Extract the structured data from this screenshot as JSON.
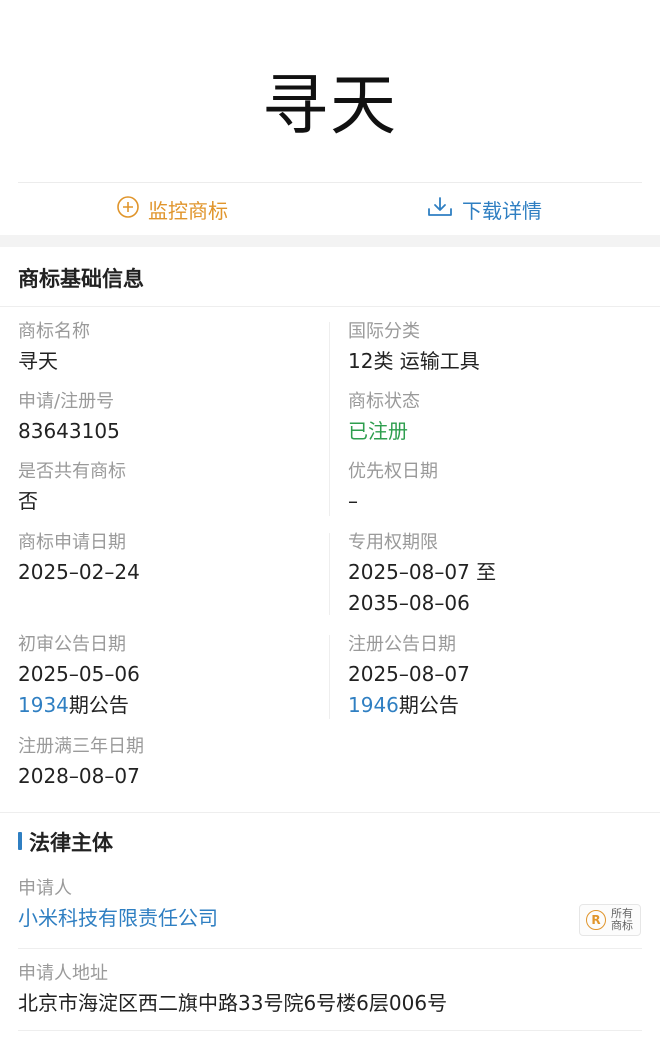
{
  "trademark_name": "寻天",
  "actions": {
    "monitor_label": "监控商标",
    "download_label": "下载详情"
  },
  "basic_info": {
    "title": "商标基础信息",
    "name_label": "商标名称",
    "name_value": "寻天",
    "class_label": "国际分类",
    "class_value": "12类 运输工具",
    "reg_no_label": "申请/注册号",
    "reg_no_value": "83643105",
    "status_label": "商标状态",
    "status_value": "已注册",
    "shared_label": "是否共有商标",
    "shared_value": "否",
    "priority_label": "优先权日期",
    "priority_value": "–",
    "apply_date_label": "商标申请日期",
    "apply_date_value": "2025–02–24",
    "exclusive_label": "专用权期限",
    "exclusive_value_1": "2025–08–07 至",
    "exclusive_value_2": "2035–08–06",
    "prelim_label": "初审公告日期",
    "prelim_date": "2025–05–06",
    "prelim_issue": "1934",
    "prelim_issue_suffix": "期公告",
    "reg_pub_label": "注册公告日期",
    "reg_pub_date": "2025–08–07",
    "reg_pub_issue": "1946",
    "reg_pub_issue_suffix": "期公告",
    "three_year_label": "注册满三年日期",
    "three_year_value": "2028–08–07"
  },
  "legal": {
    "title": "法律主体",
    "applicant_label": "申请人",
    "applicant_value": "小米科技有限责任公司",
    "badge_symbol": "R",
    "badge_line1": "所有",
    "badge_line2": "商标",
    "address_label": "申请人地址",
    "address_value": "北京市海淀区西二旗中路33号院6号楼6层006号"
  },
  "colors": {
    "accent_orange": "#e0952c",
    "link_blue": "#2f7fc2",
    "status_green": "#2e9e4e"
  }
}
